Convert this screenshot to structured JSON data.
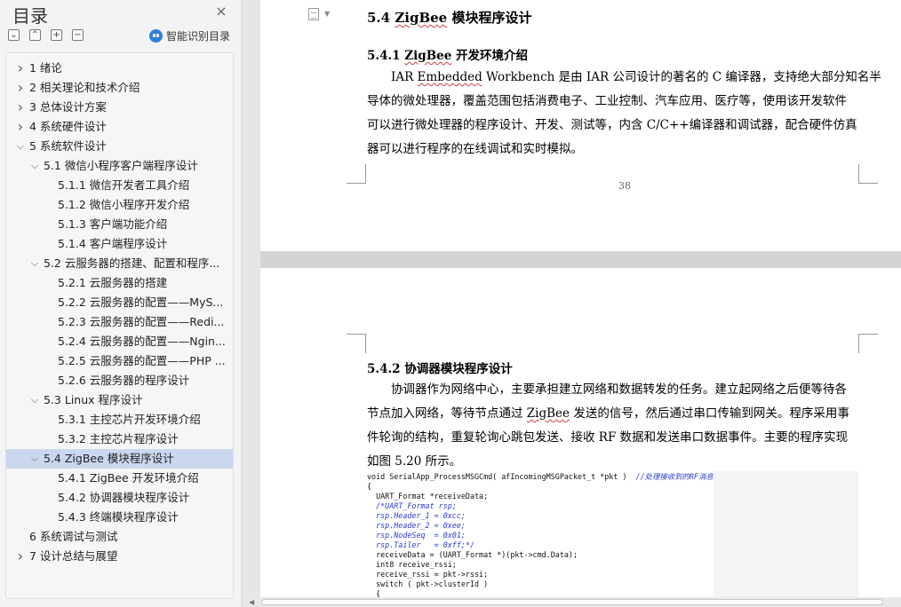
{
  "nav": {
    "title": "目录",
    "close_glyph": "×",
    "tools": {
      "collapse_all": "⌄",
      "expand_all": "⌃",
      "add": "+",
      "remove": "−"
    },
    "smart_label": "智能识别目录",
    "toc": [
      {
        "label": "1  绪论",
        "level": 0,
        "state": "collapsed"
      },
      {
        "label": "2  相关理论和技术介绍",
        "level": 0,
        "state": "collapsed"
      },
      {
        "label": "3  总体设计方案",
        "level": 0,
        "state": "collapsed"
      },
      {
        "label": "4  系统硬件设计",
        "level": 0,
        "state": "collapsed"
      },
      {
        "label": "5  系统软件设计",
        "level": 0,
        "state": "expanded"
      },
      {
        "label": "5.1  微信小程序客户端程序设计",
        "level": 1,
        "state": "expanded"
      },
      {
        "label": "5.1.1  微信开发者工具介绍",
        "level": 2,
        "state": "none"
      },
      {
        "label": "5.1.2  微信小程序开发介绍",
        "level": 2,
        "state": "none"
      },
      {
        "label": "5.1.3  客户端功能介绍",
        "level": 2,
        "state": "none"
      },
      {
        "label": "5.1.4  客户端程序设计",
        "level": 2,
        "state": "none"
      },
      {
        "label": "5.2  云服务器的搭建、配置和程序...",
        "level": 1,
        "state": "expanded"
      },
      {
        "label": "5.2.1  云服务器的搭建",
        "level": 2,
        "state": "none"
      },
      {
        "label": "5.2.2  云服务器的配置——MyS...",
        "level": 2,
        "state": "none"
      },
      {
        "label": "5.2.3  云服务器的配置——Redi...",
        "level": 2,
        "state": "none"
      },
      {
        "label": "5.2.4  云服务器的配置——Ngin...",
        "level": 2,
        "state": "none"
      },
      {
        "label": "5.2.5  云服务器的配置——PHP ...",
        "level": 2,
        "state": "none"
      },
      {
        "label": "5.2.6  云服务器的程序设计",
        "level": 2,
        "state": "none"
      },
      {
        "label": "5.3 Linux 程序设计",
        "level": 1,
        "state": "expanded"
      },
      {
        "label": "5.3.1  主控芯片开发环境介绍",
        "level": 2,
        "state": "none"
      },
      {
        "label": "5.3.2  主控芯片程序设计",
        "level": 2,
        "state": "none"
      },
      {
        "label": "5.4 ZigBee 模块程序设计",
        "level": 1,
        "state": "expanded",
        "selected": true
      },
      {
        "label": "5.4.1 ZigBee 开发环境介绍",
        "level": 2,
        "state": "none"
      },
      {
        "label": "5.4.2  协调器模块程序设计",
        "level": 2,
        "state": "none"
      },
      {
        "label": "5.4.3  终端模块程序设计",
        "level": 2,
        "state": "none"
      },
      {
        "label": "6  系统调试与测试",
        "level": 0,
        "state": "none"
      },
      {
        "label": "7  设计总结与展望",
        "level": 0,
        "state": "collapsed"
      }
    ]
  },
  "doc": {
    "page_a": {
      "heading": {
        "pre": "5.4 ",
        "wavy": "ZigBee",
        "post": " 模块程序设计"
      },
      "subheading": {
        "pre": "5.4.1 ",
        "wavy": "ZigBee",
        "post": " 开发环境介绍"
      },
      "para_lines": [
        {
          "pre": "IAR ",
          "wavy": "Embedded",
          "post": " Workbench 是由 IAR 公司设计的著名的 C 编译器，支持绝大部分知名半"
        },
        {
          "pre": "导体的微处理器，覆盖范围包括消费电子、工业控制、汽车应用、医疗等，使用该开发软件",
          "wavy": "",
          "post": ""
        },
        {
          "pre": "可以进行微处理器的程序设计、开发、测试等，内含 C/C++编译器和调试器，配合硬件仿真",
          "wavy": "",
          "post": ""
        },
        {
          "pre": "器可以进行程序的在线调试和实时模拟。",
          "wavy": "",
          "post": ""
        }
      ],
      "page_number": "38"
    },
    "page_b": {
      "subheading": "5.4.2  协调器模块程序设计",
      "para_lines": [
        {
          "pre": "协调器作为网络中心，主要承担建立网络和数据转发的任务。建立起网络之后便等待各",
          "wavy": "",
          "post": ""
        },
        {
          "pre": "节点加入网络，等待节点通过 ",
          "wavy": "ZigBee",
          "post": " 发送的信号，然后通过串口传输到网关。程序采用事"
        },
        {
          "pre": "件轮询的结构，重复轮询心跳包发送、接收 RF 数据和发送串口数据事件。主要的程序实现",
          "wavy": "",
          "post": ""
        },
        {
          "pre": "如图 5.20 所示。",
          "wavy": "",
          "post": ""
        }
      ],
      "code_lines": [
        {
          "text": "void SerialApp_ProcessMSGCmd( afIncomingMSGPacket_t *pkt )  ",
          "comment": "//处理接收到的RF消息"
        },
        {
          "text": "{",
          "comment": ""
        },
        {
          "text": "  UART_Format *receiveData;",
          "comment": ""
        },
        {
          "text": "",
          "comment": "  /*UART_Format rsp;"
        },
        {
          "text": "",
          "comment": "  rsp.Header_1 = 0xcc;"
        },
        {
          "text": "",
          "comment": "  rsp.Header_2 = 0xee;"
        },
        {
          "text": "",
          "comment": "  rsp.NodeSeq  = 0x01;"
        },
        {
          "text": "",
          "comment": "  rsp.Tailer   = 0xff;*/"
        },
        {
          "text": "  receiveData = (UART_Format *)(pkt->cmd.Data);",
          "comment": ""
        },
        {
          "text": "  int8 receive_rssi;",
          "comment": ""
        },
        {
          "text": "  receive_rssi = pkt->rssi;",
          "comment": ""
        },
        {
          "text": "  switch ( pkt->clusterId )",
          "comment": ""
        },
        {
          "text": "  {",
          "comment": ""
        }
      ]
    }
  }
}
